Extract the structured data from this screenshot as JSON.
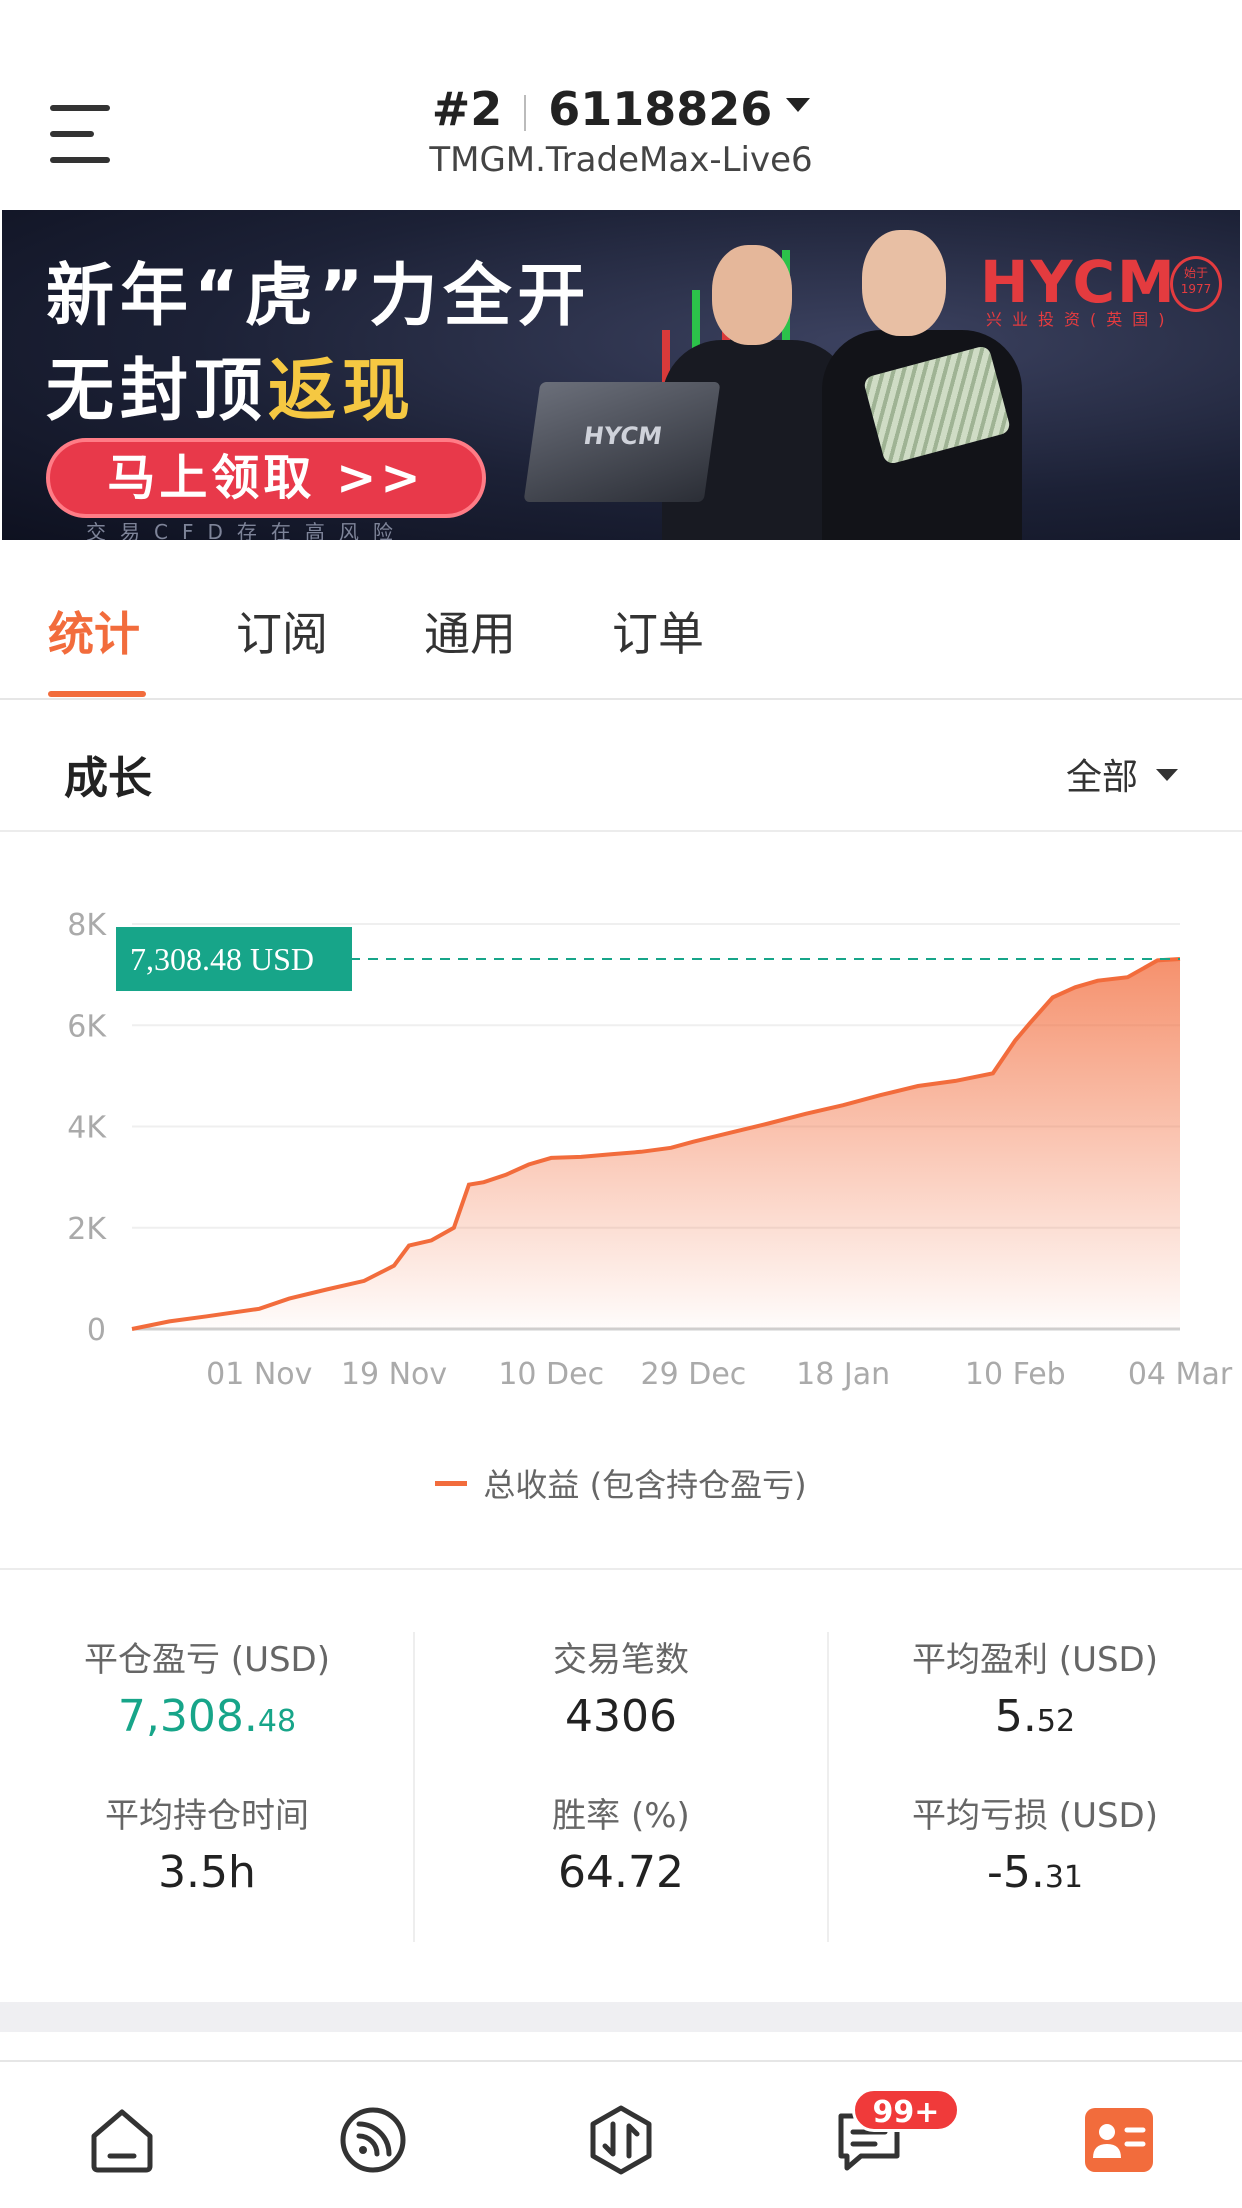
{
  "header": {
    "account_index": "#2",
    "account_number": "6118826",
    "server": "TMGM.TradeMax-Live6"
  },
  "banner": {
    "line1": "新年“虎”力全开",
    "line2_prefix": "无封顶",
    "line2_highlight": "返现",
    "cta": "马上领取 >>",
    "risk_note": "交易CFD存在高风险",
    "brand": "HYCM",
    "brand_sub": "兴业投资(英国)",
    "seal": "始于 1977"
  },
  "tabs": [
    {
      "label": "统计",
      "active": true
    },
    {
      "label": "订阅",
      "active": false
    },
    {
      "label": "通用",
      "active": false
    },
    {
      "label": "订单",
      "active": false
    }
  ],
  "section": {
    "title": "成长",
    "filter": "全部"
  },
  "chart_data": {
    "type": "area",
    "series": [
      {
        "name": "总收益 (包含持仓盈亏)",
        "color": "#f26c3c",
        "x": [
          "2021-10-15",
          "2021-10-20",
          "2021-10-25",
          "2021-11-01",
          "2021-11-05",
          "2021-11-10",
          "2021-11-15",
          "2021-11-19",
          "2021-11-21",
          "2021-11-24",
          "2021-11-27",
          "2021-11-29",
          "2021-12-01",
          "2021-12-04",
          "2021-12-07",
          "2021-12-10",
          "2021-12-14",
          "2021-12-18",
          "2021-12-22",
          "2021-12-26",
          "2021-12-29",
          "2022-01-03",
          "2022-01-08",
          "2022-01-13",
          "2022-01-18",
          "2022-01-23",
          "2022-01-28",
          "2022-02-02",
          "2022-02-07",
          "2022-02-10",
          "2022-02-12",
          "2022-02-15",
          "2022-02-18",
          "2022-02-21",
          "2022-02-25",
          "2022-03-01",
          "2022-03-04"
        ],
        "values": [
          0,
          150,
          250,
          400,
          600,
          780,
          950,
          1250,
          1650,
          1750,
          2000,
          2850,
          2900,
          3050,
          3250,
          3380,
          3400,
          3450,
          3500,
          3580,
          3700,
          3880,
          4060,
          4250,
          4420,
          4620,
          4800,
          4900,
          5050,
          5700,
          6050,
          6550,
          6750,
          6880,
          6950,
          7280,
          7308.48
        ]
      }
    ],
    "current_label": "7,308.48 USD",
    "current_value": 7308.48,
    "x_ticks": [
      "01 Nov",
      "19 Nov",
      "10 Dec",
      "29 Dec",
      "18 Jan",
      "10 Feb",
      "04 Mar"
    ],
    "y_ticks": [
      "0",
      "2K",
      "4K",
      "6K",
      "8K"
    ],
    "ylim": [
      0,
      8000
    ],
    "grid": true,
    "legend": "bottom-center"
  },
  "stats": {
    "closed_pl": {
      "label": "平仓盈亏 (USD)",
      "int": "7,308.",
      "dec": "48"
    },
    "trades": {
      "label": "交易笔数",
      "value": "4306"
    },
    "avg_profit": {
      "label": "平均盈利 (USD)",
      "int": "5.",
      "dec": "52"
    },
    "avg_hold": {
      "label": "平均持仓时间",
      "value": "3.5h"
    },
    "win_rate": {
      "label": "胜率 (%)",
      "value": "64.72"
    },
    "avg_loss": {
      "label": "平均亏损 (USD)",
      "int": "-5.",
      "dec": "31"
    }
  },
  "nav": {
    "badge": "99+"
  }
}
